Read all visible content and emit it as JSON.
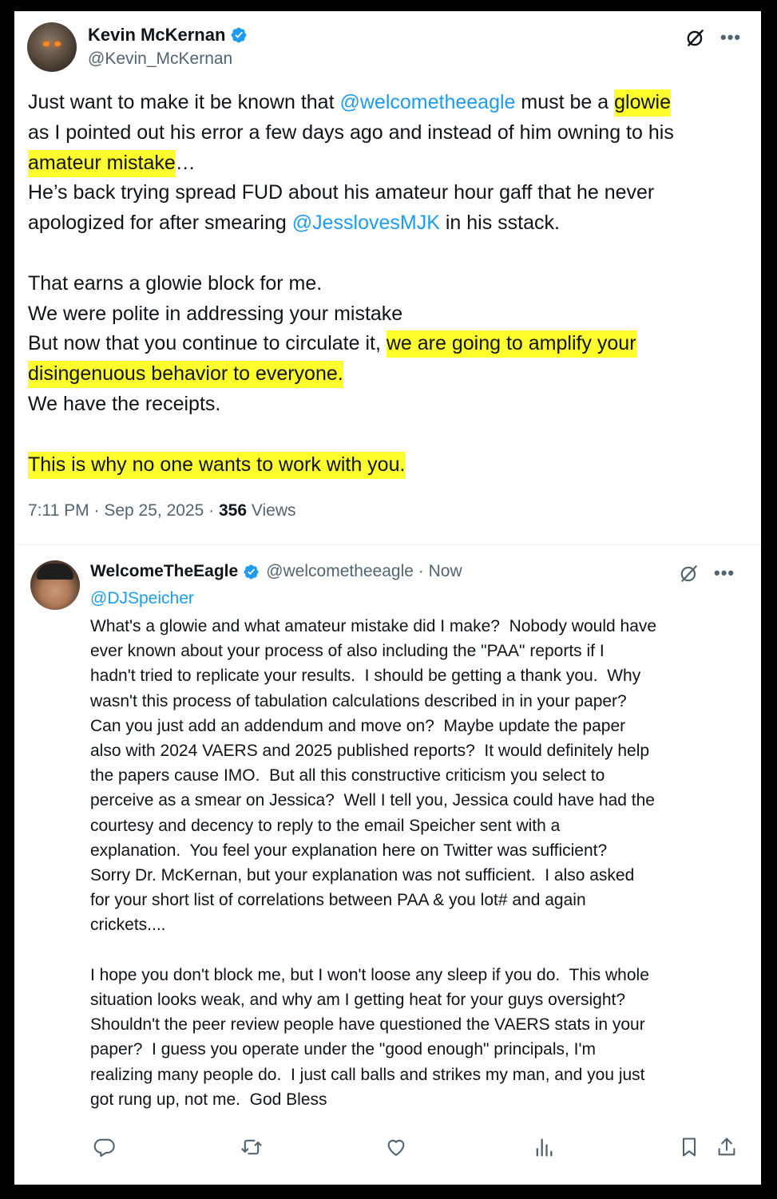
{
  "main_tweet": {
    "author": {
      "display_name": "Kevin McKernan",
      "handle": "@Kevin_McKernan",
      "verified": true
    },
    "body_segments": [
      {
        "text": "Just want to make it be known that ",
        "style": "text"
      },
      {
        "text": "@welcometheeagle",
        "style": "mention"
      },
      {
        "text": " must be a ",
        "style": "text"
      },
      {
        "text": "glowie",
        "style": "highlight"
      },
      {
        "text": "\nas I pointed out his error a few days ago and instead of him owning to his\n",
        "style": "text"
      },
      {
        "text": "amateur mistake",
        "style": "highlight"
      },
      {
        "text": "…\nHe’s back trying spread FUD about his amateur hour gaff that he never\napologized for after smearing ",
        "style": "text"
      },
      {
        "text": "@JesslovesMJK",
        "style": "mention"
      },
      {
        "text": " in his sstack.\n\nThat earns a glowie block for me.\nWe were polite in addressing your mistake\nBut now that you continue to circulate it, ",
        "style": "text"
      },
      {
        "text": "we are going to amplify your\ndisingenuous behavior to everyone.",
        "style": "highlight"
      },
      {
        "text": "\nWe have the receipts.\n\n",
        "style": "text"
      },
      {
        "text": "This is why no one wants to work with you.",
        "style": "highlight"
      }
    ],
    "time": "7:11 PM",
    "date": "Sep 25, 2025",
    "separator": "·",
    "views_count": "356",
    "views_label": "Views",
    "icons": {
      "grok": "grok-icon",
      "more": "more-icon"
    }
  },
  "reply": {
    "author": {
      "display_name": "WelcomeTheEagle",
      "handle": "@welcometheeagle · Now",
      "verified": true
    },
    "replying_to": "@DJSpeicher",
    "body": "What's a glowie and what amateur mistake did I make?  Nobody would have\never known about your process of also including the \"PAA\" reports if I\nhadn't tried to replicate your results.  I should be getting a thank you.  Why\nwasn't this process of tabulation calculations described in in your paper?\nCan you just add an addendum and move on?  Maybe update the paper\nalso with 2024 VAERS and 2025 published reports?  It would definitely help\nthe papers cause IMO.  But all this constructive criticism you select to\nperceive as a smear on Jessica?  Well I tell you, Jessica could have had the\ncourtesy and decency to reply to the email Speicher sent with a\nexplanation.  You feel your explanation here on Twitter was sufficient?\nSorry Dr. McKernan, but your explanation was not sufficient.  I also asked\nfor your short list of correlations between PAA & you lot# and again\ncrickets....\n\nI hope you don't block me, but I won't loose any sleep if you do.  This whole\nsituation looks weak, and why am I getting heat for your guys oversight?\nShouldn't the peer review people have questioned the VAERS stats in your\npaper?  I guess you operate under the \"good enough\" principals, I'm\nrealizing many people do.  I just call balls and strikes my man, and you just\ngot rung up, not me.  God Bless",
    "actions": [
      "reply-icon",
      "retweet-icon",
      "like-icon",
      "views-icon",
      "bookmark-icon",
      "share-icon"
    ]
  },
  "colors": {
    "accent": "#1d9bf0",
    "highlight": "#ffff2e",
    "secondary_text": "#536471",
    "primary_text": "#0f1419",
    "frame": "#000000"
  }
}
